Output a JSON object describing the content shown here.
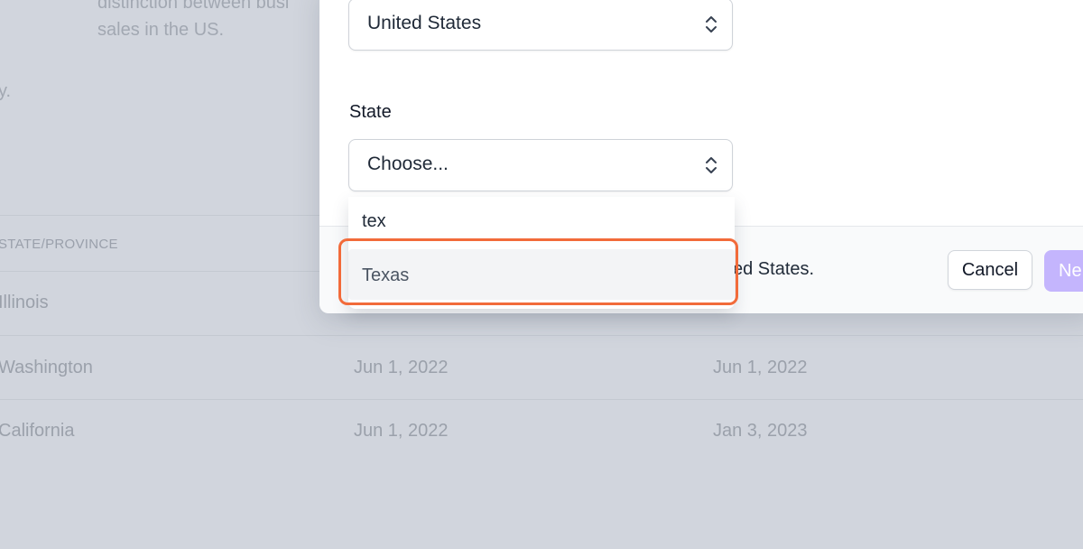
{
  "background": {
    "description_lines": [
      "distinction between busi",
      "sales in the US."
    ],
    "fragment": "y.",
    "table": {
      "column_header": "STATE/PROVINCE",
      "rows": [
        {
          "state": "Illinois",
          "date1": "",
          "date2": ""
        },
        {
          "state": "Washington",
          "date1": "Jun 1, 2022",
          "date2": "Jun 1, 2022"
        },
        {
          "state": "California",
          "date1": "Jun 1, 2022",
          "date2": "Jan 3, 2023"
        }
      ]
    }
  },
  "modal": {
    "country_select": {
      "value": "United States"
    },
    "state_label": "State",
    "state_select": {
      "value": "Choose..."
    },
    "dropdown": {
      "search_value": "tex",
      "options": [
        {
          "label": "Texas",
          "highlighted": true
        }
      ]
    },
    "footer": {
      "text": "ited States.",
      "cancel_label": "Cancel",
      "next_label": "Ne"
    }
  },
  "colors": {
    "accent": "#c4b5fd",
    "highlight": "#f26b3a"
  },
  "icons": {
    "select_chevron": "chevron-up-down-icon"
  }
}
